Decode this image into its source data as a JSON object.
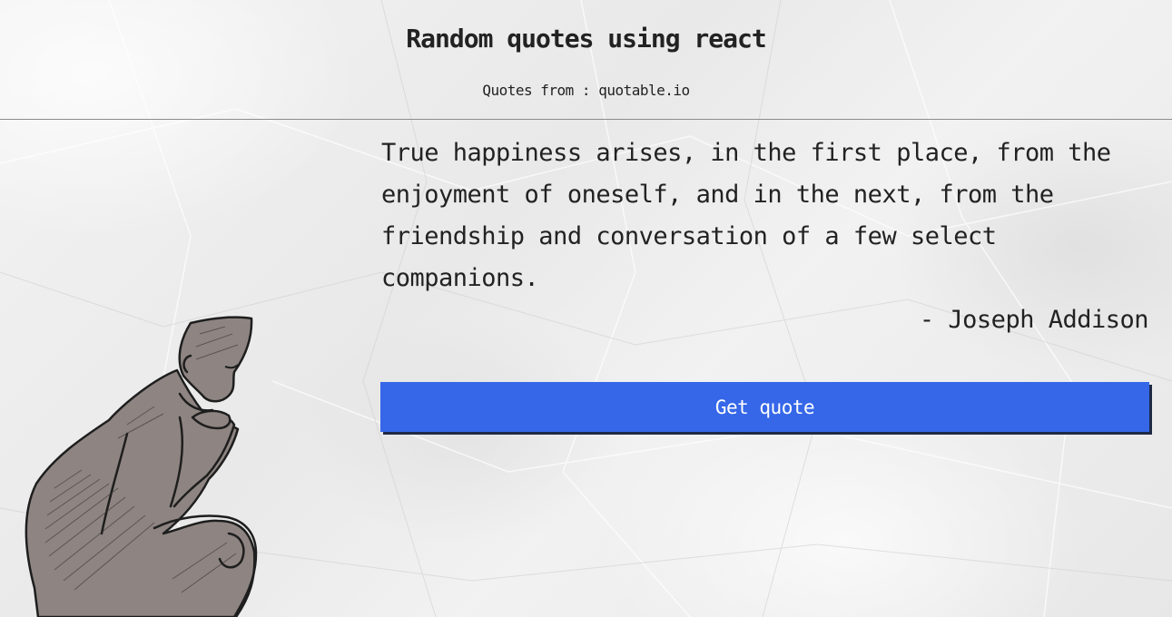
{
  "header": {
    "title": "Random quotes using react",
    "source_label": "Quotes from : quotable.io"
  },
  "quote": {
    "text": "True happiness arises, in the first place, from the enjoyment of oneself, and in the next, from the friendship and conversation of a few select companions.",
    "author": "- Joseph Addison"
  },
  "actions": {
    "get_quote_label": "Get quote"
  },
  "illustration": {
    "icon": "thinker-illustration",
    "skin_color": "#8e8582"
  },
  "colors": {
    "button_bg": "#3567e8",
    "button_shadow": "#1e2a45",
    "text": "#222222",
    "background": "#ededed"
  }
}
